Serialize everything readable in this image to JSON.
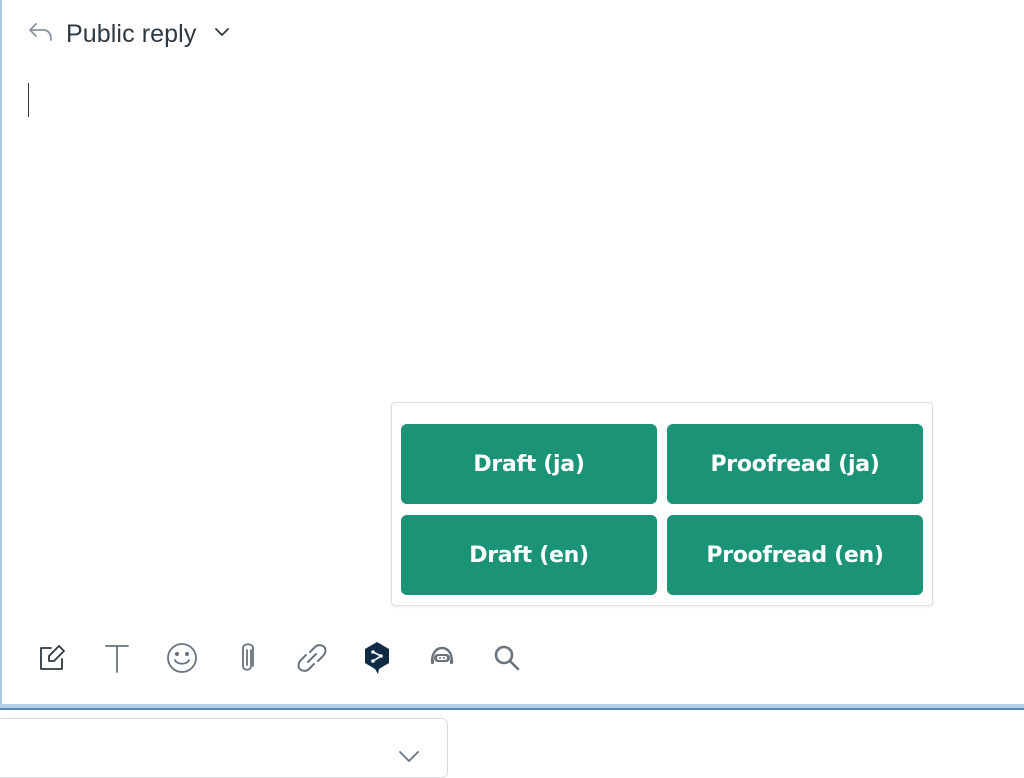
{
  "reply": {
    "channel_label": "Public reply",
    "reply_icon": "reply-arrow-icon",
    "dropdown_icon": "chevron-down-icon"
  },
  "editor": {
    "value": "",
    "focused": true
  },
  "macros": {
    "buttons": [
      {
        "label": "Draft (ja)"
      },
      {
        "label": "Proofread (ja)"
      },
      {
        "label": "Draft (en)"
      },
      {
        "label": "Proofread (en)"
      }
    ],
    "button_color": "#1b9377"
  },
  "toolbar": {
    "items": [
      {
        "name": "compose-icon",
        "tooltip": "Format"
      },
      {
        "name": "text-format-icon",
        "tooltip": "Text"
      },
      {
        "name": "emoji-icon",
        "tooltip": "Emoji"
      },
      {
        "name": "attachment-icon",
        "tooltip": "Attach"
      },
      {
        "name": "link-icon",
        "tooltip": "Link"
      },
      {
        "name": "deepl-icon",
        "tooltip": "DeepL"
      },
      {
        "name": "ai-bot-icon",
        "tooltip": "AI assistant"
      },
      {
        "name": "search-icon",
        "tooltip": "Search"
      }
    ]
  },
  "bottom_select": {
    "value": "",
    "icon": "chevron-down-icon"
  },
  "colors": {
    "text": "#2f3941",
    "icon": "#68737d",
    "focus_border": "#a8cbe6",
    "deepl": "#0f2b46"
  }
}
